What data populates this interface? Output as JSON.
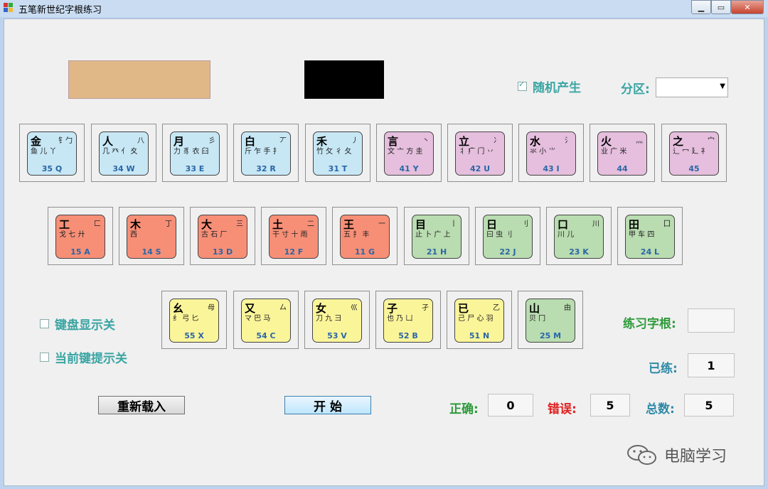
{
  "window": {
    "title": "五笔新世纪字根练习"
  },
  "options": {
    "random_label": "随机产生",
    "zone_label": "分区:",
    "zone_value": "",
    "keyboard_display_label": "键盘显示关",
    "current_key_hint_label": "当前键提示关"
  },
  "practice": {
    "root_label": "练习字根:",
    "root_value": "",
    "done_label": "已练:",
    "done_value": "1",
    "correct_label": "正确:",
    "correct_value": "0",
    "wrong_label": "错误:",
    "wrong_value": "5",
    "total_label": "总数:",
    "total_value": "5"
  },
  "buttons": {
    "reload": "重新载入",
    "start": "开 始"
  },
  "colors": {
    "blue": "#c7e7f5",
    "pink": "#e5bfdd",
    "red": "#f78f77",
    "green": "#b9dcb0",
    "yellow": "#fbf59a",
    "display_tan": "#e0b888",
    "display_black": "#000000"
  },
  "keys_row1": [
    {
      "main": "金",
      "side": "钅勹",
      "roots": "鱼 儿 丫",
      "code": "35 Q",
      "color": "blue"
    },
    {
      "main": "人",
      "side": "八",
      "roots": "几 癶 亻 夊",
      "code": "34 W",
      "color": "blue"
    },
    {
      "main": "月",
      "side": "彡",
      "roots": "力 豸 衣 臼",
      "code": "33 E",
      "color": "blue"
    },
    {
      "main": "白",
      "side": "丆",
      "roots": "斤 乍 手 扌",
      "code": "32 R",
      "color": "blue"
    },
    {
      "main": "禾",
      "side": "丿",
      "roots": "竹 攵 彳 夂",
      "code": "31 T",
      "color": "blue"
    },
    {
      "main": "言",
      "side": "丶",
      "roots": "文 亠 方 圭",
      "code": "41 Y",
      "color": "pink"
    },
    {
      "main": "立",
      "side": "冫",
      "roots": "丬 疒 门 丷",
      "code": "42 U",
      "color": "pink"
    },
    {
      "main": "水",
      "side": "氵",
      "roots": "氺 小 ⺌",
      "code": "43 I",
      "color": "pink"
    },
    {
      "main": "火",
      "side": "灬",
      "roots": "业 广 米",
      "code": "44",
      "color": "pink"
    },
    {
      "main": "之",
      "side": "宀",
      "roots": "辶 冖 廴 礻",
      "code": "45",
      "color": "pink"
    }
  ],
  "keys_row2": [
    {
      "main": "工",
      "side": "匚",
      "roots": "戈 七 廾",
      "code": "15 A",
      "color": "red"
    },
    {
      "main": "木",
      "side": "丁",
      "roots": "西",
      "code": "14 S",
      "color": "red"
    },
    {
      "main": "大",
      "side": "三",
      "roots": "古 石 厂",
      "code": "13 D",
      "color": "red"
    },
    {
      "main": "土",
      "side": "二",
      "roots": "干 寸 十 雨",
      "code": "12 F",
      "color": "red"
    },
    {
      "main": "王",
      "side": "一",
      "roots": "五 扌 丰",
      "code": "11 G",
      "color": "red"
    },
    {
      "main": "目",
      "side": "丨",
      "roots": "止 卜 广 上",
      "code": "21 H",
      "color": "green"
    },
    {
      "main": "日",
      "side": "刂",
      "roots": "曰 虫 刂",
      "code": "22 J",
      "color": "green"
    },
    {
      "main": "口",
      "side": "川",
      "roots": "川 儿",
      "code": "23 K",
      "color": "green"
    },
    {
      "main": "田",
      "side": "囗",
      "roots": "甲 车 四",
      "code": "24 L",
      "color": "green"
    }
  ],
  "keys_row3": [
    {
      "main": "幺",
      "side": "母",
      "roots": "纟 弓 匕",
      "code": "55 X",
      "color": "yellow"
    },
    {
      "main": "又",
      "side": "厶",
      "roots": "マ 巴 马",
      "code": "54 C",
      "color": "yellow"
    },
    {
      "main": "女",
      "side": "巛",
      "roots": "刀 九 彐",
      "code": "53 V",
      "color": "yellow"
    },
    {
      "main": "子",
      "side": "孑",
      "roots": "也 乃 凵",
      "code": "52 B",
      "color": "yellow"
    },
    {
      "main": "已",
      "side": "乙",
      "roots": "己 尸 心 羽",
      "code": "51 N",
      "color": "yellow"
    },
    {
      "main": "山",
      "side": "由",
      "roots": "贝 冂",
      "code": "25 M",
      "color": "green"
    }
  ],
  "watermark": {
    "text": "电脑学习",
    "icon": "wechat-icon"
  }
}
